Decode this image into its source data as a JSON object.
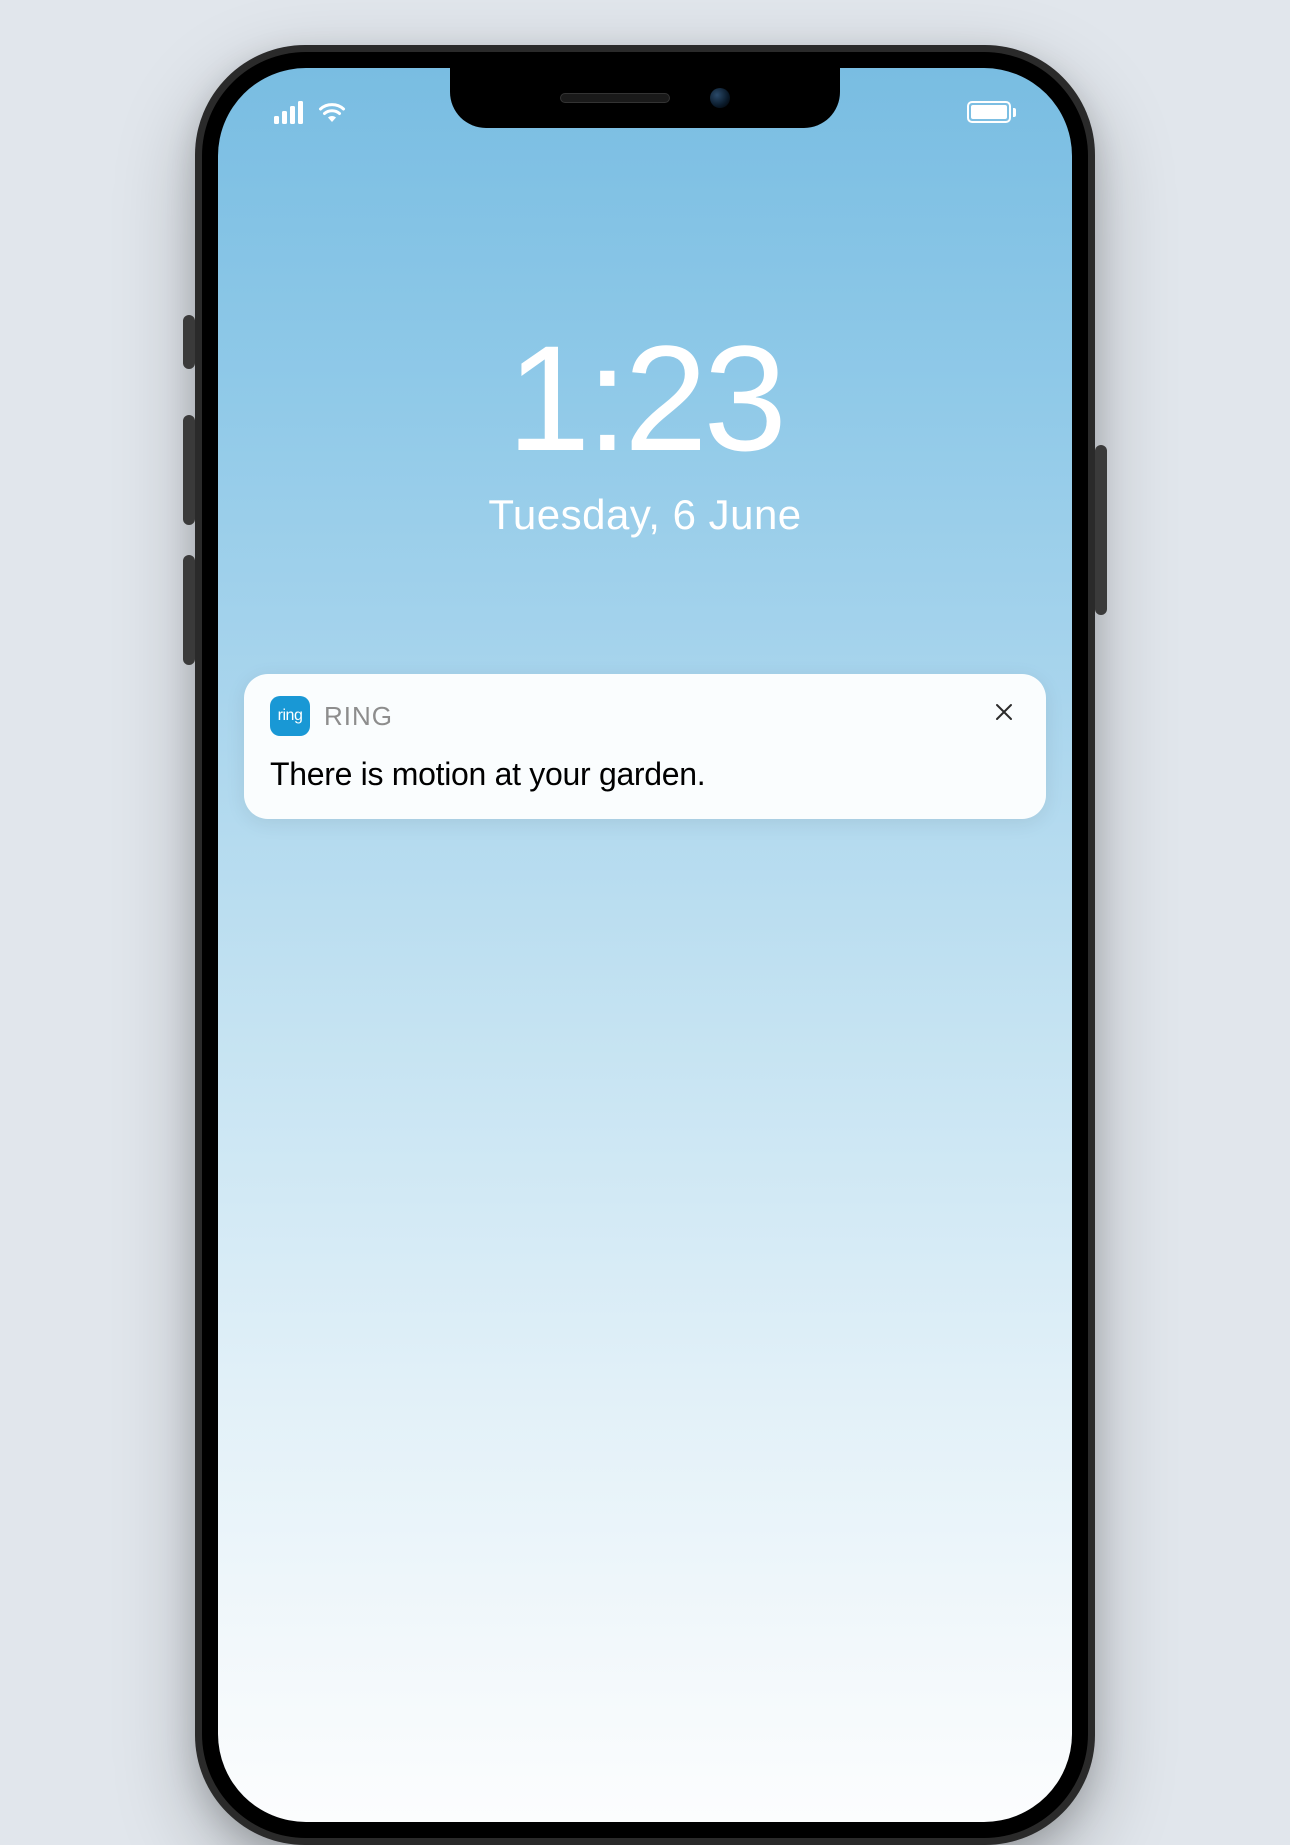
{
  "lockscreen": {
    "time": "1:23",
    "date": "Tuesday, 6 June"
  },
  "notification": {
    "app_icon_label": "ring",
    "app_name": "RING",
    "message": "There is motion at your garden."
  }
}
